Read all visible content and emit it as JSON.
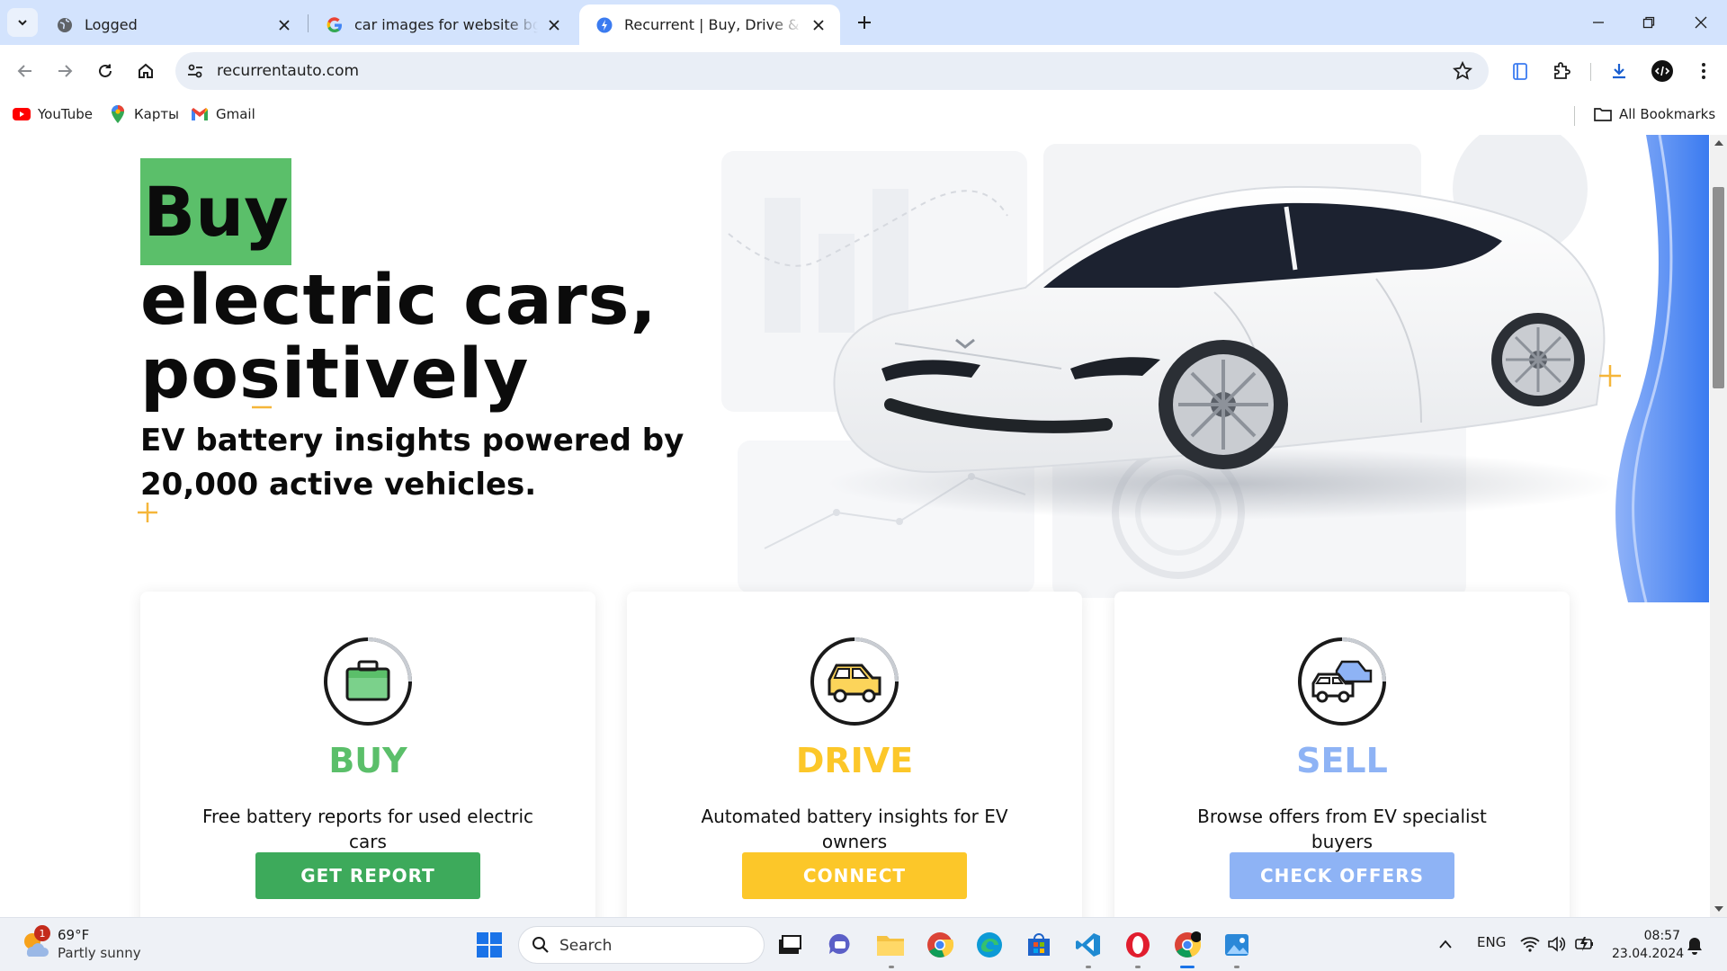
{
  "browser": {
    "tabs": [
      {
        "title": "Logged",
        "favicon": "globe-icon",
        "active": false
      },
      {
        "title": "car images for website bg non",
        "favicon": "google-icon",
        "active": false
      },
      {
        "title": "Recurrent | Buy, Drive & Sell Ele",
        "favicon": "recurrent-bolt-icon",
        "active": true
      }
    ],
    "url": "recurrentauto.com",
    "bookmarks": [
      {
        "label": "YouTube",
        "icon": "youtube-icon"
      },
      {
        "label": "Карты",
        "icon": "maps-pin-icon"
      },
      {
        "label": "Gmail",
        "icon": "gmail-icon"
      }
    ],
    "all_bookmarks_label": "All Bookmarks"
  },
  "page": {
    "hero": {
      "highlight_word": "Buy",
      "line1": "electric cars,",
      "line2": "positively",
      "subtitle": "EV battery insights powered by 20,000 active vehicles."
    },
    "cards": [
      {
        "title": "BUY",
        "description": "Free battery reports for used electric cars",
        "button": "GET REPORT",
        "color": "#5bbf6a",
        "icon": "briefcase-icon"
      },
      {
        "title": "DRIVE",
        "description": "Automated battery insights for EV owners",
        "button": "CONNECT",
        "color": "#fcc729",
        "icon": "car-icon"
      },
      {
        "title": "SELL",
        "description": "Browse offers from EV specialist buyers",
        "button": "CHECK OFFERS",
        "color": "#8eb3f5",
        "icon": "cars-trade-icon"
      }
    ]
  },
  "taskbar": {
    "weather": {
      "temp": "69°F",
      "condition": "Partly sunny",
      "badge": "1"
    },
    "search_label": "Search",
    "language": "ENG",
    "time": "08:57",
    "date": "23.04.2024"
  },
  "colors": {
    "tab_strip": "#d3e3fd",
    "buy_green": "#5bbf6a",
    "drive_yellow": "#fcc729",
    "sell_blue": "#8eb3f5",
    "accent_blue": "#3b7bf0"
  }
}
